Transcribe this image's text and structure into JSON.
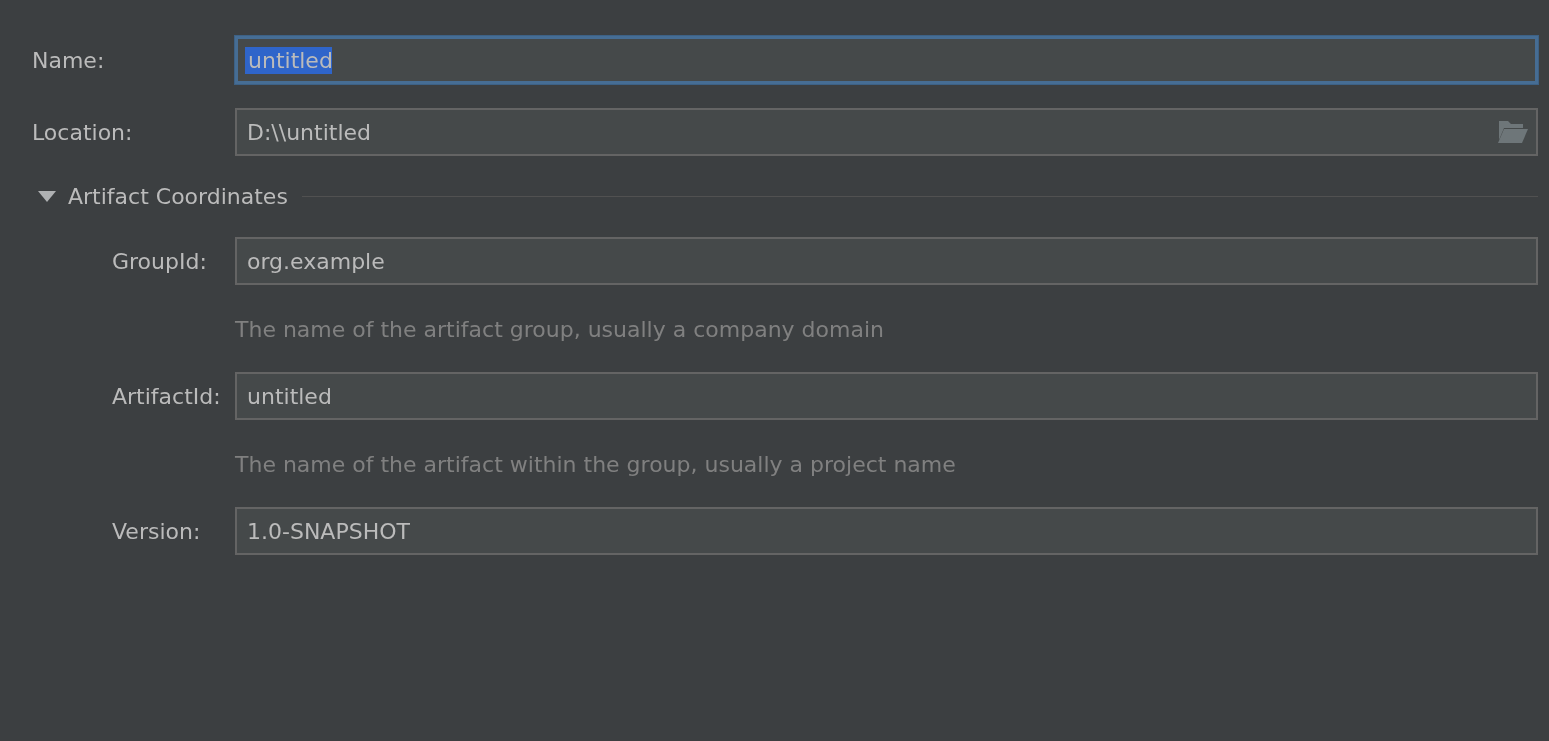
{
  "fields": [
    {
      "kind": "text",
      "label": "Name:",
      "value": "untitled",
      "focused": true
    },
    {
      "kind": "path",
      "label": "Location:",
      "value": "D:\\\\untitled",
      "focused": false
    }
  ],
  "section": {
    "title": "Artifact Coordinates",
    "expanded": true,
    "fields": [
      {
        "label": "GroupId:",
        "value": "org.example",
        "hint": "The name of the artifact group, usually a company domain"
      },
      {
        "label": "ArtifactId:",
        "value": "untitled",
        "hint": "The name of the artifact within the group, usually a project name"
      },
      {
        "label": "Version:",
        "value": "1.0-SNAPSHOT"
      }
    ]
  }
}
